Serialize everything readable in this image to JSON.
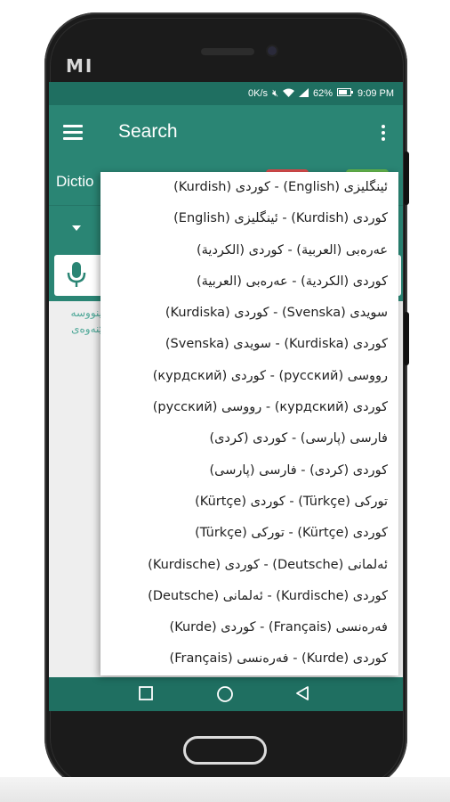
{
  "phone": {
    "brand": "MI"
  },
  "status_bar": {
    "network_speed": "0K/s",
    "battery": "62%",
    "time": "9:09 PM"
  },
  "app_bar": {
    "title": "Search"
  },
  "sub_bar": {
    "label": "Dictio"
  },
  "hint_lines": [
    "ینووسه",
    "ێنەوەی"
  ],
  "dropdown": {
    "options": [
      "ئینگلیزی (English) - کوردی (Kurdish)",
      "کوردی (Kurdish) - ئینگلیزی (English)",
      "عەرەبی (العربية) - کوردی (الكردية)",
      "کوردی (الكردية) - عەرەبی (العربية)",
      "سویدی (Svenska) - کوردی (Kurdiska)",
      "کوردی (Kurdiska) - سویدی (Svenska)",
      "رووسی (русский) - کوردی (курдский)",
      "کوردی (курдский) - رووسی (русский)",
      "فارسی (پارسی) - کوردی (کردی)",
      "کوردی (کردی) - فارسی (پارسی)",
      "تورکی (Türkçe) - کوردی (Kürtçe)",
      "کوردی (Kürtçe) - تورکی (Türkçe)",
      "ئەلمانی (Deutsche) - کوردی (Kurdische)",
      "کوردی (Kurdische) - ئەلمانی (Deutsche)",
      "فەرەنسی (Français) - کوردی (Kurde)",
      "کوردی (Kurde) - فەرەنسی (Français)"
    ]
  },
  "colors": {
    "primary": "#2a8574",
    "primary_dark": "#1f6f61",
    "accent_red": "#d94b4b",
    "accent_green": "#63b54b"
  }
}
